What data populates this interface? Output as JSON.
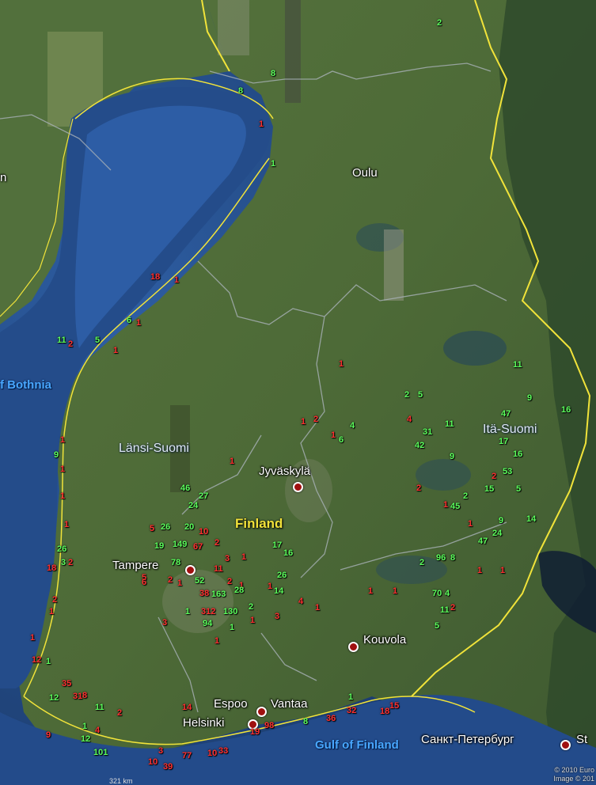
{
  "map": {
    "places": {
      "oulu": "Oulu",
      "jyvaskyla": "Jyväskylä",
      "tampere": "Tampere",
      "kouvola": "Kouvola",
      "espoo": "Espoo",
      "vantaa": "Vantaa",
      "helsinki": "Helsinki",
      "st_petersburg": "Санкт-Петербург",
      "st_cut": "St",
      "n_cut": "n"
    },
    "regions": {
      "lansi": "Länsi-Suomi",
      "ita": "Itä-Suomi",
      "country": "Finland"
    },
    "water": {
      "bothnia": "f Bothnia",
      "gulf": "Gulf of Finland"
    },
    "attribution": {
      "line1": "© 2010 Euro",
      "line2": "Image © 201"
    },
    "scale": "321 km",
    "marker_colors": {
      "green": "#5cff5c",
      "red": "#ff3030"
    },
    "markers": [
      {
        "t": "2",
        "c": "g"
      },
      {
        "t": "8",
        "c": "g"
      },
      {
        "t": "8",
        "c": "g"
      },
      {
        "t": "1",
        "c": "r"
      },
      {
        "t": "1",
        "c": "g"
      },
      {
        "t": "18",
        "c": "r"
      },
      {
        "t": "1",
        "c": "r"
      },
      {
        "t": "6",
        "c": "g"
      },
      {
        "t": "1",
        "c": "r"
      },
      {
        "t": "11",
        "c": "g"
      },
      {
        "t": "2",
        "c": "r"
      },
      {
        "t": "5",
        "c": "g"
      },
      {
        "t": "1",
        "c": "r"
      },
      {
        "t": "1",
        "c": "r"
      },
      {
        "t": "11",
        "c": "g"
      },
      {
        "t": "2",
        "c": "g"
      },
      {
        "t": "5",
        "c": "g"
      },
      {
        "t": "9",
        "c": "g"
      },
      {
        "t": "16",
        "c": "g"
      },
      {
        "t": "4",
        "c": "r"
      },
      {
        "t": "11",
        "c": "g"
      },
      {
        "t": "47",
        "c": "g"
      },
      {
        "t": "31",
        "c": "g"
      },
      {
        "t": "42",
        "c": "g"
      },
      {
        "t": "17",
        "c": "g"
      },
      {
        "t": "16",
        "c": "g"
      },
      {
        "t": "1",
        "c": "r"
      },
      {
        "t": "2",
        "c": "r"
      },
      {
        "t": "1",
        "c": "r"
      },
      {
        "t": "4",
        "c": "g"
      },
      {
        "t": "6",
        "c": "g"
      },
      {
        "t": "9",
        "c": "g"
      },
      {
        "t": "53",
        "c": "g"
      },
      {
        "t": "2",
        "c": "r"
      },
      {
        "t": "15",
        "c": "g"
      },
      {
        "t": "5",
        "c": "g"
      },
      {
        "t": "2",
        "c": "r"
      },
      {
        "t": "1",
        "c": "r"
      },
      {
        "t": "45",
        "c": "g"
      },
      {
        "t": "2",
        "c": "g"
      },
      {
        "t": "1",
        "c": "r"
      },
      {
        "t": "9",
        "c": "g"
      },
      {
        "t": "24",
        "c": "g"
      },
      {
        "t": "47",
        "c": "g"
      },
      {
        "t": "14",
        "c": "g"
      },
      {
        "t": "2",
        "c": "g"
      },
      {
        "t": "96",
        "c": "g"
      },
      {
        "t": "8",
        "c": "g"
      },
      {
        "t": "1",
        "c": "r"
      },
      {
        "t": "1",
        "c": "r"
      },
      {
        "t": "1",
        "c": "r"
      },
      {
        "t": "1",
        "c": "r"
      },
      {
        "t": "70",
        "c": "g"
      },
      {
        "t": "4",
        "c": "g"
      },
      {
        "t": "11",
        "c": "g"
      },
      {
        "t": "2",
        "c": "r"
      },
      {
        "t": "5",
        "c": "g"
      },
      {
        "t": "1",
        "c": "r"
      },
      {
        "t": "1",
        "c": "r"
      },
      {
        "t": "9",
        "c": "g"
      },
      {
        "t": "1",
        "c": "r"
      },
      {
        "t": "1",
        "c": "r"
      },
      {
        "t": "3",
        "c": "g"
      },
      {
        "t": "26",
        "c": "g"
      },
      {
        "t": "5",
        "c": "r"
      },
      {
        "t": "18",
        "c": "r"
      },
      {
        "t": "2",
        "c": "r"
      },
      {
        "t": "1",
        "c": "r"
      },
      {
        "t": "46",
        "c": "g"
      },
      {
        "t": "27",
        "c": "g"
      },
      {
        "t": "24",
        "c": "g"
      },
      {
        "t": "5",
        "c": "r"
      },
      {
        "t": "26",
        "c": "g"
      },
      {
        "t": "20",
        "c": "g"
      },
      {
        "t": "10",
        "c": "r"
      },
      {
        "t": "19",
        "c": "g"
      },
      {
        "t": "149",
        "c": "g"
      },
      {
        "t": "67",
        "c": "r"
      },
      {
        "t": "78",
        "c": "g"
      },
      {
        "t": "2",
        "c": "r"
      },
      {
        "t": "3",
        "c": "r"
      },
      {
        "t": "1",
        "c": "r"
      },
      {
        "t": "11",
        "c": "r"
      },
      {
        "t": "1",
        "c": "r"
      },
      {
        "t": "6",
        "c": "r"
      },
      {
        "t": "2",
        "c": "r"
      },
      {
        "t": "52",
        "c": "g"
      },
      {
        "t": "1",
        "c": "r"
      },
      {
        "t": "2",
        "c": "r"
      },
      {
        "t": "38",
        "c": "r"
      },
      {
        "t": "163",
        "c": "g"
      },
      {
        "t": "28",
        "c": "g"
      },
      {
        "t": "1",
        "c": "r"
      },
      {
        "t": "1",
        "c": "g"
      },
      {
        "t": "312",
        "c": "r"
      },
      {
        "t": "130",
        "c": "g"
      },
      {
        "t": "2",
        "c": "g"
      },
      {
        "t": "3",
        "c": "r"
      },
      {
        "t": "94",
        "c": "g"
      },
      {
        "t": "1",
        "c": "r"
      },
      {
        "t": "1",
        "c": "r"
      },
      {
        "t": "17",
        "c": "g"
      },
      {
        "t": "16",
        "c": "g"
      },
      {
        "t": "26",
        "c": "g"
      },
      {
        "t": "14",
        "c": "g"
      },
      {
        "t": "4",
        "c": "r"
      },
      {
        "t": "1",
        "c": "r"
      },
      {
        "t": "3",
        "c": "r"
      },
      {
        "t": "1",
        "c": "g"
      },
      {
        "t": "2",
        "c": "r"
      },
      {
        "t": "1",
        "c": "r"
      },
      {
        "t": "1",
        "c": "r"
      },
      {
        "t": "12",
        "c": "r"
      },
      {
        "t": "1",
        "c": "g"
      },
      {
        "t": "35",
        "c": "r"
      },
      {
        "t": "12",
        "c": "g"
      },
      {
        "t": "31",
        "c": "r"
      },
      {
        "t": "8",
        "c": "r"
      },
      {
        "t": "2",
        "c": "r"
      },
      {
        "t": "11",
        "c": "g"
      },
      {
        "t": "1",
        "c": "g"
      },
      {
        "t": "4",
        "c": "r"
      },
      {
        "t": "9",
        "c": "r"
      },
      {
        "t": "12",
        "c": "g"
      },
      {
        "t": "101",
        "c": "g"
      },
      {
        "t": "10",
        "c": "r"
      },
      {
        "t": "39",
        "c": "r"
      },
      {
        "t": "77",
        "c": "r"
      },
      {
        "t": "10",
        "c": "r"
      },
      {
        "t": "33",
        "c": "r"
      },
      {
        "t": "19",
        "c": "r"
      },
      {
        "t": "98",
        "c": "r"
      },
      {
        "t": "8",
        "c": "g"
      },
      {
        "t": "36",
        "c": "r"
      },
      {
        "t": "32",
        "c": "r"
      },
      {
        "t": "15",
        "c": "r"
      },
      {
        "t": "18",
        "c": "r"
      },
      {
        "t": "1",
        "c": "g"
      },
      {
        "t": "14",
        "c": "r"
      },
      {
        "t": "3",
        "c": "r"
      },
      {
        "t": "1",
        "c": "r"
      },
      {
        "t": "1",
        "c": "r"
      },
      {
        "t": "1",
        "c": "g"
      }
    ]
  }
}
